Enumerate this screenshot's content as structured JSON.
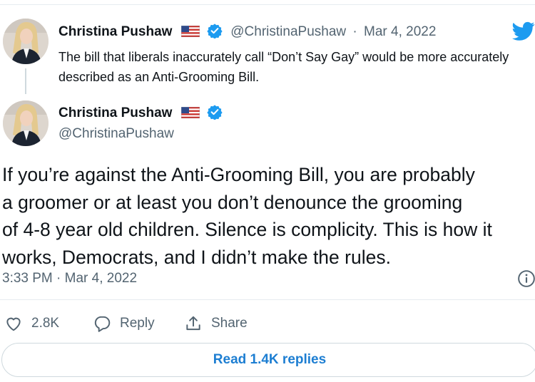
{
  "quoted_tweet": {
    "display_name": "Christina Pushaw",
    "handle": "@ChristinaPushaw",
    "separator": "·",
    "date": "Mar 4, 2022",
    "text": "The bill that liberals inaccurately call “Don’t Say Gay” would be more accurately described as an Anti-Grooming Bill."
  },
  "main_tweet": {
    "display_name": "Christina Pushaw",
    "handle": "@ChristinaPushaw",
    "text_lines": [
      "If you’re against the Anti-Grooming Bill, you are probably",
      "a groomer or at least you don’t denounce the grooming",
      "of 4-8 year old children. Silence is complicity. This is how it",
      "works, Democrats, and I didn’t make the rules."
    ],
    "timestamp": "3:33 PM · Mar 4, 2022"
  },
  "actions": {
    "like_count": "2.8K",
    "reply_label": "Reply",
    "share_label": "Share"
  },
  "read_replies_label": "Read 1.4K replies",
  "colors": {
    "accent": "#1d9bf0",
    "link": "#1d7ed2",
    "muted": "#536471",
    "border": "#cfd9de"
  },
  "icons": [
    "twitter-bird-icon",
    "us-flag-icon",
    "verified-badge-icon",
    "info-icon",
    "heart-icon",
    "reply-bubble-icon",
    "share-icon"
  ]
}
